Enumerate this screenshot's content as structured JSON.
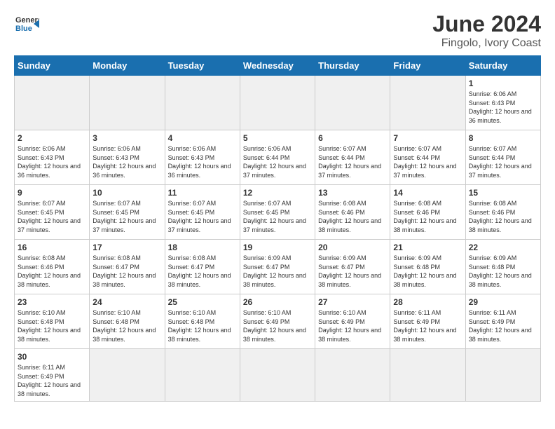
{
  "header": {
    "logo_general": "General",
    "logo_blue": "Blue",
    "title": "June 2024",
    "subtitle": "Fingolo, Ivory Coast"
  },
  "days_of_week": [
    "Sunday",
    "Monday",
    "Tuesday",
    "Wednesday",
    "Thursday",
    "Friday",
    "Saturday"
  ],
  "weeks": [
    [
      {
        "day": null,
        "info": null
      },
      {
        "day": null,
        "info": null
      },
      {
        "day": null,
        "info": null
      },
      {
        "day": null,
        "info": null
      },
      {
        "day": null,
        "info": null
      },
      {
        "day": null,
        "info": null
      },
      {
        "day": "1",
        "info": "Sunrise: 6:06 AM\nSunset: 6:43 PM\nDaylight: 12 hours\nand 36 minutes."
      }
    ],
    [
      {
        "day": "2",
        "info": "Sunrise: 6:06 AM\nSunset: 6:43 PM\nDaylight: 12 hours\nand 36 minutes."
      },
      {
        "day": "3",
        "info": "Sunrise: 6:06 AM\nSunset: 6:43 PM\nDaylight: 12 hours\nand 36 minutes."
      },
      {
        "day": "4",
        "info": "Sunrise: 6:06 AM\nSunset: 6:43 PM\nDaylight: 12 hours\nand 36 minutes."
      },
      {
        "day": "5",
        "info": "Sunrise: 6:06 AM\nSunset: 6:44 PM\nDaylight: 12 hours\nand 37 minutes."
      },
      {
        "day": "6",
        "info": "Sunrise: 6:07 AM\nSunset: 6:44 PM\nDaylight: 12 hours\nand 37 minutes."
      },
      {
        "day": "7",
        "info": "Sunrise: 6:07 AM\nSunset: 6:44 PM\nDaylight: 12 hours\nand 37 minutes."
      },
      {
        "day": "8",
        "info": "Sunrise: 6:07 AM\nSunset: 6:44 PM\nDaylight: 12 hours\nand 37 minutes."
      }
    ],
    [
      {
        "day": "9",
        "info": "Sunrise: 6:07 AM\nSunset: 6:45 PM\nDaylight: 12 hours\nand 37 minutes."
      },
      {
        "day": "10",
        "info": "Sunrise: 6:07 AM\nSunset: 6:45 PM\nDaylight: 12 hours\nand 37 minutes."
      },
      {
        "day": "11",
        "info": "Sunrise: 6:07 AM\nSunset: 6:45 PM\nDaylight: 12 hours\nand 37 minutes."
      },
      {
        "day": "12",
        "info": "Sunrise: 6:07 AM\nSunset: 6:45 PM\nDaylight: 12 hours\nand 37 minutes."
      },
      {
        "day": "13",
        "info": "Sunrise: 6:08 AM\nSunset: 6:46 PM\nDaylight: 12 hours\nand 38 minutes."
      },
      {
        "day": "14",
        "info": "Sunrise: 6:08 AM\nSunset: 6:46 PM\nDaylight: 12 hours\nand 38 minutes."
      },
      {
        "day": "15",
        "info": "Sunrise: 6:08 AM\nSunset: 6:46 PM\nDaylight: 12 hours\nand 38 minutes."
      }
    ],
    [
      {
        "day": "16",
        "info": "Sunrise: 6:08 AM\nSunset: 6:46 PM\nDaylight: 12 hours\nand 38 minutes."
      },
      {
        "day": "17",
        "info": "Sunrise: 6:08 AM\nSunset: 6:47 PM\nDaylight: 12 hours\nand 38 minutes."
      },
      {
        "day": "18",
        "info": "Sunrise: 6:08 AM\nSunset: 6:47 PM\nDaylight: 12 hours\nand 38 minutes."
      },
      {
        "day": "19",
        "info": "Sunrise: 6:09 AM\nSunset: 6:47 PM\nDaylight: 12 hours\nand 38 minutes."
      },
      {
        "day": "20",
        "info": "Sunrise: 6:09 AM\nSunset: 6:47 PM\nDaylight: 12 hours\nand 38 minutes."
      },
      {
        "day": "21",
        "info": "Sunrise: 6:09 AM\nSunset: 6:48 PM\nDaylight: 12 hours\nand 38 minutes."
      },
      {
        "day": "22",
        "info": "Sunrise: 6:09 AM\nSunset: 6:48 PM\nDaylight: 12 hours\nand 38 minutes."
      }
    ],
    [
      {
        "day": "23",
        "info": "Sunrise: 6:10 AM\nSunset: 6:48 PM\nDaylight: 12 hours\nand 38 minutes."
      },
      {
        "day": "24",
        "info": "Sunrise: 6:10 AM\nSunset: 6:48 PM\nDaylight: 12 hours\nand 38 minutes."
      },
      {
        "day": "25",
        "info": "Sunrise: 6:10 AM\nSunset: 6:48 PM\nDaylight: 12 hours\nand 38 minutes."
      },
      {
        "day": "26",
        "info": "Sunrise: 6:10 AM\nSunset: 6:49 PM\nDaylight: 12 hours\nand 38 minutes."
      },
      {
        "day": "27",
        "info": "Sunrise: 6:10 AM\nSunset: 6:49 PM\nDaylight: 12 hours\nand 38 minutes."
      },
      {
        "day": "28",
        "info": "Sunrise: 6:11 AM\nSunset: 6:49 PM\nDaylight: 12 hours\nand 38 minutes."
      },
      {
        "day": "29",
        "info": "Sunrise: 6:11 AM\nSunset: 6:49 PM\nDaylight: 12 hours\nand 38 minutes."
      }
    ],
    [
      {
        "day": "30",
        "info": "Sunrise: 6:11 AM\nSunset: 6:49 PM\nDaylight: 12 hours\nand 38 minutes."
      },
      {
        "day": null,
        "info": null
      },
      {
        "day": null,
        "info": null
      },
      {
        "day": null,
        "info": null
      },
      {
        "day": null,
        "info": null
      },
      {
        "day": null,
        "info": null
      },
      {
        "day": null,
        "info": null
      }
    ]
  ]
}
